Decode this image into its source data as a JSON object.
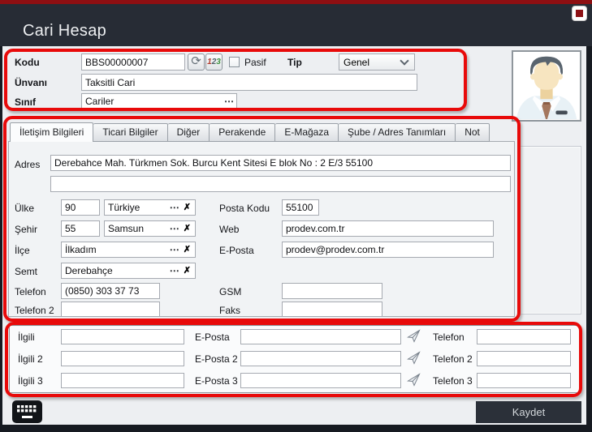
{
  "window": {
    "title": "Cari Hesap"
  },
  "colors": {
    "annotation_red": "#e80a0a",
    "title_bar_red": "#8e0f12",
    "header_bg": "#272c35",
    "save_button_bg": "#2b3039"
  },
  "icons": {
    "refresh": "⟳",
    "num_1": "1",
    "num_2": "2",
    "num_3": "3",
    "ellipsis": "⋯",
    "clear_x": "✗"
  },
  "identity": {
    "kodu_label": "Kodu",
    "kodu_value": "BBS00000007",
    "pasif_label": "Pasif",
    "tip_label": "Tip",
    "tip_value": "Genel",
    "unvani_label": "Ünvanı",
    "unvani_value": "Taksitli Cari",
    "sinif_label": "Sınıf",
    "sinif_value": "Cariler"
  },
  "tabs": [
    {
      "label": "İletişim Bilgileri",
      "active": true
    },
    {
      "label": "Ticari Bilgiler",
      "active": false
    },
    {
      "label": "Diğer",
      "active": false
    },
    {
      "label": "Perakende",
      "active": false
    },
    {
      "label": "E-Mağaza",
      "active": false
    },
    {
      "label": "Şube / Adres Tanımları",
      "active": false
    },
    {
      "label": "Not",
      "active": false
    }
  ],
  "contact": {
    "adres_label": "Adres",
    "adres_value": "Derebahce Mah. Türkmen Sok. Burcu Kent Sitesi E blok No : 2 E/3 55100",
    "adres_line2": "",
    "ulke_label": "Ülke",
    "ulke_code": "90",
    "ulke_name": "Türkiye",
    "sehir_label": "Şehir",
    "sehir_code": "55",
    "sehir_name": "Samsun",
    "ilce_label": "İlçe",
    "ilce_name": "İlkadım",
    "semt_label": "Semt",
    "semt_name": "Derebahçe",
    "posta_kodu_label": "Posta Kodu",
    "posta_kodu_value": "55100",
    "web_label": "Web",
    "web_value": "prodev.com.tr",
    "eposta_label": "E-Posta",
    "eposta_value": "prodev@prodev.com.tr",
    "telefon_label": "Telefon",
    "telefon_value": "(0850) 303 37 73",
    "telefon2_label": "Telefon 2",
    "telefon2_value": "",
    "gsm_label": "GSM",
    "gsm_value": "",
    "faks_label": "Faks",
    "faks_value": ""
  },
  "contacts_rows": [
    {
      "ilgili_label": "İlgili",
      "ilgili_value": "",
      "eposta_label": "E-Posta",
      "eposta_value": "",
      "telefon_label": "Telefon",
      "telefon_value": ""
    },
    {
      "ilgili_label": "İlgili 2",
      "ilgili_value": "",
      "eposta_label": "E-Posta 2",
      "eposta_value": "",
      "telefon_label": "Telefon 2",
      "telefon_value": ""
    },
    {
      "ilgili_label": "İlgili 3",
      "ilgili_value": "",
      "eposta_label": "E-Posta 3",
      "eposta_value": "",
      "telefon_label": "Telefon 3",
      "telefon_value": ""
    }
  ],
  "footer": {
    "save_label": "Kaydet"
  }
}
